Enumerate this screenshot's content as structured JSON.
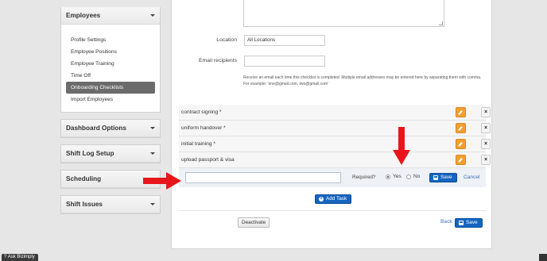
{
  "sidebar": {
    "employees_title": "Employees",
    "employees_items": [
      {
        "label": "Profile Settings",
        "active": false
      },
      {
        "label": "Employee Positions",
        "active": false
      },
      {
        "label": "Employee Training",
        "active": false
      },
      {
        "label": "Time Off",
        "active": false
      },
      {
        "label": "Onboarding Checklists",
        "active": true
      },
      {
        "label": "Import Employees",
        "active": false
      }
    ],
    "sections": [
      "Dashboard Options",
      "Shift Log Setup",
      "Scheduling",
      "Shift Issues"
    ]
  },
  "form": {
    "location_label": "Location",
    "location_value": "All Locations",
    "email_label": "Email recipients",
    "email_value": "",
    "help_text": "Receive an email each time this checklist is completed. Multiple email addresses may be entered here by separating them with comma. For example: 'one@gmail.com, two@gmail.com'"
  },
  "tasks": [
    {
      "label": "contract signing *"
    },
    {
      "label": "uniform handover *"
    },
    {
      "label": "initial training *"
    },
    {
      "label": "upload passport & visa"
    }
  ],
  "new_task": {
    "value": "",
    "required_label": "Required?",
    "yes_label": "Yes",
    "no_label": "No",
    "required": "yes",
    "save_label": "Save",
    "cancel_label": "Cancel"
  },
  "add_task_label": "Add Task",
  "footer": {
    "deactivate_label": "Deactivate",
    "back_label": "Back",
    "save_label": "Save"
  },
  "ask_label": "Ask Bizimply",
  "colors": {
    "primary": "#1565c0",
    "edit": "#f0a030",
    "arrow": "#e8161a",
    "active_menu": "#6b6b6b"
  }
}
